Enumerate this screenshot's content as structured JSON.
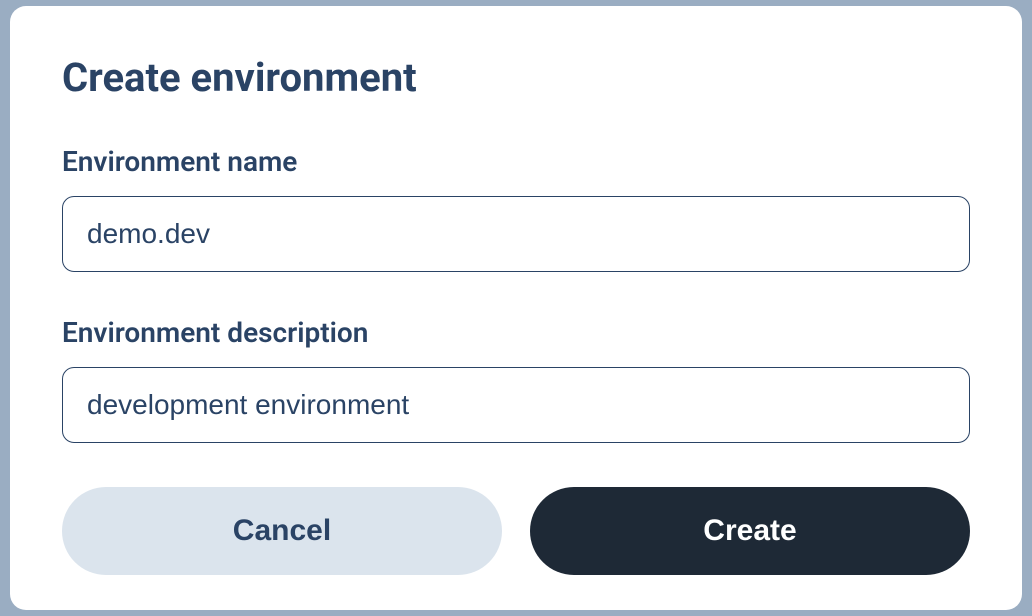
{
  "modal": {
    "title": "Create environment",
    "fields": {
      "name": {
        "label": "Environment name",
        "value": "demo.dev"
      },
      "description": {
        "label": "Environment description",
        "value": "development environment"
      }
    },
    "buttons": {
      "cancel": "Cancel",
      "create": "Create"
    }
  }
}
